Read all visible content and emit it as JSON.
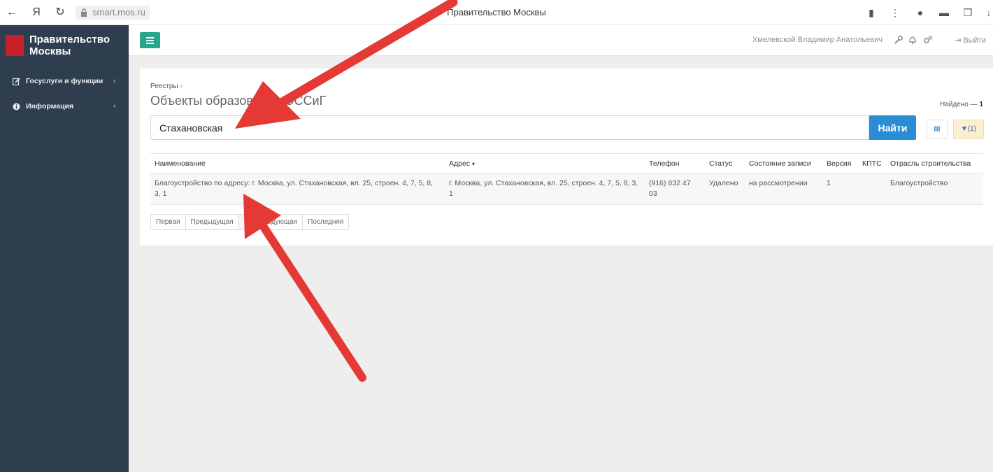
{
  "browser": {
    "url": "smart.mos.ru",
    "tab_title": "Правительство Москвы"
  },
  "sidebar": {
    "brand": "Правительство Москвы",
    "items": [
      {
        "label": "Госуслуги и функции",
        "icon": "edit-icon"
      },
      {
        "label": "Информация",
        "icon": "info-icon"
      }
    ]
  },
  "topbar": {
    "user_name": "Хмелевской Владимир Анатольевич",
    "logout_label": "Выйти"
  },
  "page": {
    "breadcrumb": "Реестры",
    "title": "Объекты образования ОССиГ",
    "found_label": "Найдено —",
    "found_count": "1"
  },
  "search": {
    "value": "Стахановская",
    "button_label": "Найти",
    "columns_label": "III",
    "filter_label": "(1)"
  },
  "table": {
    "headers": [
      "Наименование",
      "Адрес",
      "Телефон",
      "Статус",
      "Состояние записи",
      "Версия",
      "КПТС",
      "Отрасль строительства"
    ],
    "rows": [
      {
        "name": "Благоустройство по адресу: г. Москва, ул. Стахановская, вл. 25, строен. 4, 7, 5, 8, 3, 1",
        "address": "г. Москва, ул. Стахановская, вл. 25, строен. 4, 7, 5, 8, 3, 1",
        "phone": "(916) 832 47 03",
        "status": "Удалено",
        "state": "на рассмотрении",
        "version": "1",
        "kpts": "",
        "industry": "Благоустройство"
      }
    ]
  },
  "pager": {
    "first": "Первая",
    "prev": "Предыдущая",
    "page": "1",
    "next": "Следующая",
    "last": "Последняя"
  },
  "colors": {
    "sidebar": "#2f3e4e",
    "accent_green": "#26a68b",
    "accent_blue": "#2a8dd4",
    "arrow": "#e53935"
  }
}
